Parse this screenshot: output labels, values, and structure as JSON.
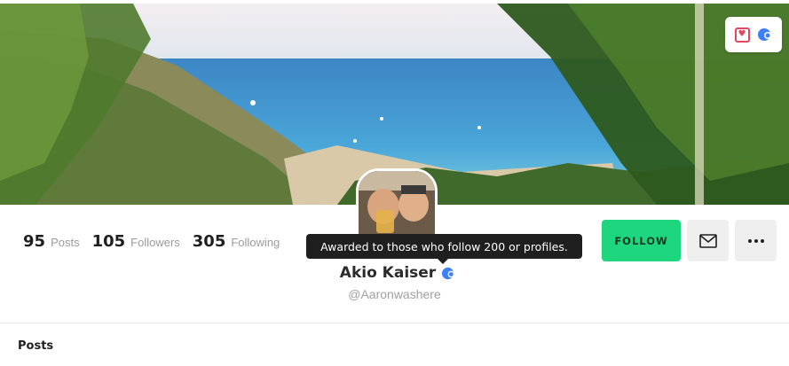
{
  "profile": {
    "name": "Akio Kaiser",
    "handle": "@Aaronwashere"
  },
  "stats": [
    {
      "value": "95",
      "label": "Posts"
    },
    {
      "value": "105",
      "label": "Followers"
    },
    {
      "value": "305",
      "label": "Following"
    }
  ],
  "tooltip": {
    "text": "Awarded to those who follow 200 or profiles."
  },
  "actions": {
    "follow_label": "FOLLOW"
  },
  "section": {
    "posts_title": "Posts"
  },
  "icons": {
    "top_badges": [
      "heart-badge-icon",
      "people-badge-icon"
    ],
    "name_badge": "people-verified-icon",
    "message": "envelope-icon",
    "more": "ellipsis-icon"
  },
  "colors": {
    "accent_green": "#1ed67e",
    "badge_blue": "#3d7ff5",
    "badge_red": "#e5465f",
    "tooltip_bg": "#1f1f1f"
  }
}
